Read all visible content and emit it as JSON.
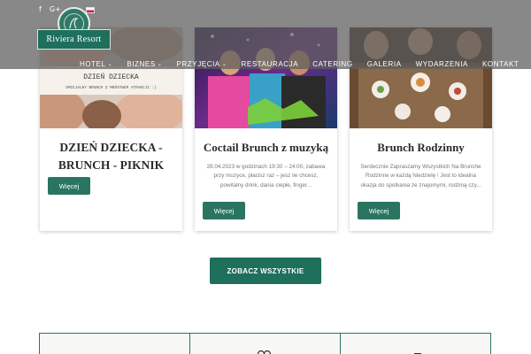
{
  "header": {
    "social": [
      {
        "icon": "facebook-icon",
        "glyph": "f"
      },
      {
        "icon": "google-plus-icon",
        "glyph": "G+"
      }
    ],
    "logo_text": "Riviera Resort",
    "nav": [
      {
        "label": "HOTEL",
        "dropdown": true
      },
      {
        "label": "BIZNES",
        "dropdown": true
      },
      {
        "label": "PRZYJĘCIA",
        "dropdown": true
      },
      {
        "label": "RESTAURACJA",
        "dropdown": false
      },
      {
        "label": "CATERING",
        "dropdown": false
      },
      {
        "label": "GALERIA",
        "dropdown": false
      },
      {
        "label": "WYDARZENIA",
        "dropdown": false
      },
      {
        "label": "KONTAKT",
        "dropdown": false
      }
    ]
  },
  "cards": [
    {
      "image_banner_title": "DZIEŃ DZIECKA",
      "image_banner_sub": "SPECJALNY BRUNCH Z MNÓSTWEM ATRAKCJI :)",
      "title_line1": "DZIEŃ DZIECKA -",
      "title_line2": "BRUNCH - PIKNIK",
      "desc": "",
      "button": "Więcej"
    },
    {
      "title_line1": "Coctail Brunch z muzyką",
      "desc": "28.04.2023 w godzinach 19:30 – 24:00, zabawa przy muzyce, płacisz raz – jesz ile chcesz, powitalny drink, dania ciepłe, finger...",
      "button": "Więcej"
    },
    {
      "title_line1": "Brunch Rodzinny",
      "desc": "Serdecznie Zapraszamy Wszystkich Na Brunche Rodzinne w każdą Niedzielę ! Jest to idealna okazja do spotkania ze znajomymi, rodziną czy...",
      "button": "Więcej"
    }
  ],
  "see_all": "ZOBACZ WSZYSTKIE",
  "colors": {
    "accent": "#2a7562",
    "header_overlay": "#5f5f5f"
  }
}
